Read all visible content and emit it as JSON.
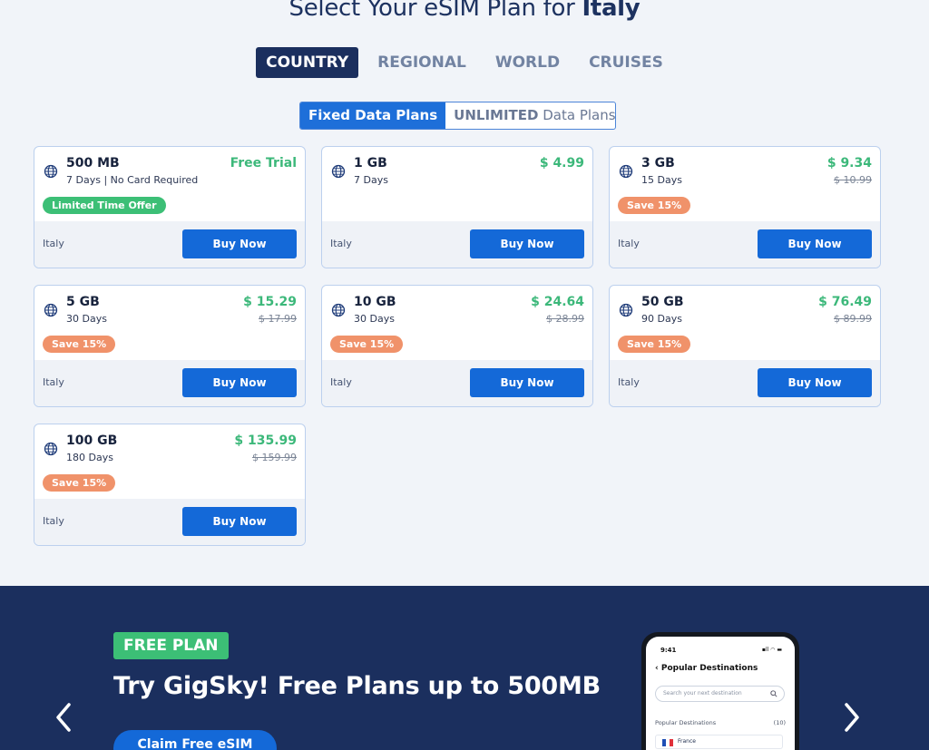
{
  "heading": {
    "prefix": "Select Your eSIM Plan for ",
    "country": "Italy"
  },
  "tabs": [
    {
      "label": "COUNTRY",
      "active": true
    },
    {
      "label": "REGIONAL",
      "active": false
    },
    {
      "label": "WORLD",
      "active": false
    },
    {
      "label": "CRUISES",
      "active": false
    }
  ],
  "plan_toggle": {
    "fixed_label": "Fixed Data Plans",
    "unlimited_bold": "UNLIMITED",
    "unlimited_rest": " Data Plans"
  },
  "plans": [
    {
      "data": "500 MB",
      "days": "7 Days | No Card Required",
      "price": "Free Trial",
      "original": "",
      "badge": "Limited Time Offer",
      "badge_color": "#3cbf76",
      "country": "Italy",
      "button": "Buy Now"
    },
    {
      "data": "1 GB",
      "days": "7 Days",
      "price": "$ 4.99",
      "original": "",
      "badge": "",
      "badge_color": "",
      "country": "Italy",
      "button": "Buy Now"
    },
    {
      "data": "3 GB",
      "days": "15 Days",
      "price": "$ 9.34",
      "original": "$ 10.99",
      "badge": "Save 15%",
      "badge_color": "#f0926a",
      "country": "Italy",
      "button": "Buy Now"
    },
    {
      "data": "5 GB",
      "days": "30 Days",
      "price": "$ 15.29",
      "original": "$ 17.99",
      "badge": "Save 15%",
      "badge_color": "#f0926a",
      "country": "Italy",
      "button": "Buy Now"
    },
    {
      "data": "10 GB",
      "days": "30 Days",
      "price": "$ 24.64",
      "original": "$ 28.99",
      "badge": "Save 15%",
      "badge_color": "#f0926a",
      "country": "Italy",
      "button": "Buy Now"
    },
    {
      "data": "50 GB",
      "days": "90 Days",
      "price": "$ 76.49",
      "original": "$ 89.99",
      "badge": "Save 15%",
      "badge_color": "#f0926a",
      "country": "Italy",
      "button": "Buy Now"
    },
    {
      "data": "100 GB",
      "days": "180 Days",
      "price": "$ 135.99",
      "original": "$ 159.99",
      "badge": "Save 15%",
      "badge_color": "#f0926a",
      "country": "Italy",
      "button": "Buy Now"
    }
  ],
  "banner": {
    "badge": "FREE PLAN",
    "title": "Try GigSky! Free Plans up to 500MB",
    "cta": "Claim Free eSIM",
    "phone": {
      "time": "9:41",
      "status": "▪ll ◠ ▬",
      "title": "Popular Destinations",
      "search_placeholder": "Search your next destination",
      "section_label": "Popular Destinations",
      "section_count": "(10)",
      "first_country": "France"
    }
  },
  "colors": {
    "navy": "#1b2f5e",
    "accent_blue": "#1469d8",
    "green": "#3cbf76",
    "orange": "#f0926a",
    "price_green": "#3cb87a"
  },
  "icons": {
    "plan": "globe-icon",
    "prev": "chevron-left-icon",
    "next": "chevron-right-icon",
    "phone_back": "chevron-left-icon",
    "phone_search": "search-icon"
  }
}
